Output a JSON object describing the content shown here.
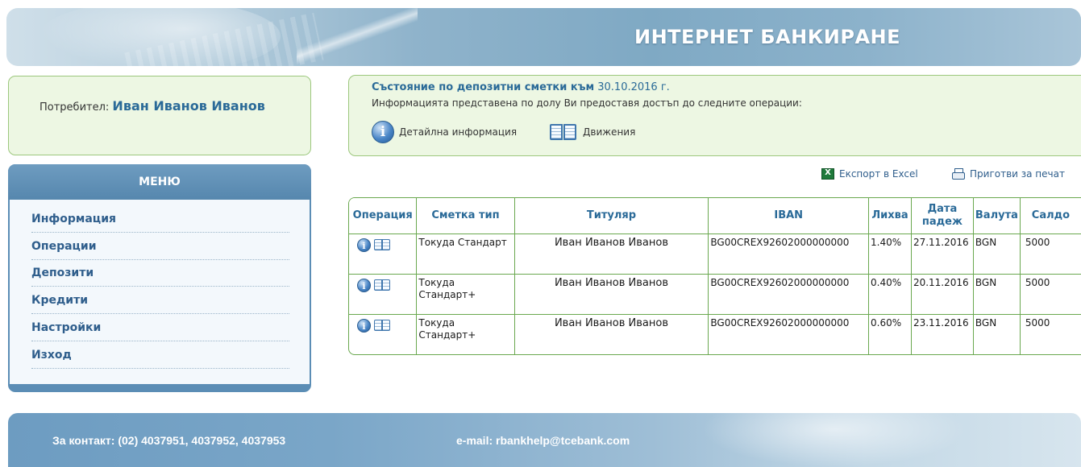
{
  "header": {
    "title": "ИНТЕРНЕТ БАНКИРАНЕ"
  },
  "user": {
    "label": "Потребител:",
    "name": "Иван Иванов Иванов"
  },
  "menu": {
    "title": "МЕНЮ",
    "items": [
      "Информация",
      "Операции",
      "Депозити",
      "Кредити",
      "Настройки",
      "Изход"
    ]
  },
  "deposits": {
    "status_prefix": "Състояние по депозитни сметки към",
    "status_date": "30.10.2016 г.",
    "description": "Информацията представена по долу Ви предоставя достъп до следните операции:",
    "operations": [
      {
        "label": "Детайлна информация",
        "icon": "info-icon"
      },
      {
        "label": "Движения",
        "icon": "book-icon"
      }
    ]
  },
  "export": {
    "excel_label": "Експорт в Excel",
    "print_label": "Приготви за печат"
  },
  "table": {
    "headers": [
      "Операция",
      "Сметка тип",
      "Титуляр",
      "IBAN",
      "Лихва",
      "Дата падеж",
      "Валута",
      "Салдо"
    ],
    "rows": [
      {
        "type": "Токуда Стандарт",
        "holder": "Иван Иванов Иванов",
        "iban": "BG00CREX92602000000000",
        "interest": "1.40%",
        "due_date": "27.11.2016",
        "currency": "BGN",
        "balance": "5000"
      },
      {
        "type": "Токуда Стандарт+",
        "holder": "Иван Иванов Иванов",
        "iban": "BG00CREX92602000000000",
        "interest": "0.40%",
        "due_date": "20.11.2016",
        "currency": "BGN",
        "balance": "5000"
      },
      {
        "type": "Токуда Стандарт+",
        "holder": "Иван Иванов Иванов",
        "iban": "BG00CREX92602000000000",
        "interest": "0.60%",
        "due_date": "23.11.2016",
        "currency": "BGN",
        "balance": "5000"
      }
    ]
  },
  "footer": {
    "contact": "За контакт: (02) 4037951, 4037952, 4037953",
    "email": "e-mail: rbankhelp@tcebank.com"
  },
  "colors": {
    "accent_blue": "#2a6a98",
    "panel_green_bg": "#edf7e3",
    "panel_green_border": "#9cc77d",
    "menu_blue": "#5b8db5"
  }
}
